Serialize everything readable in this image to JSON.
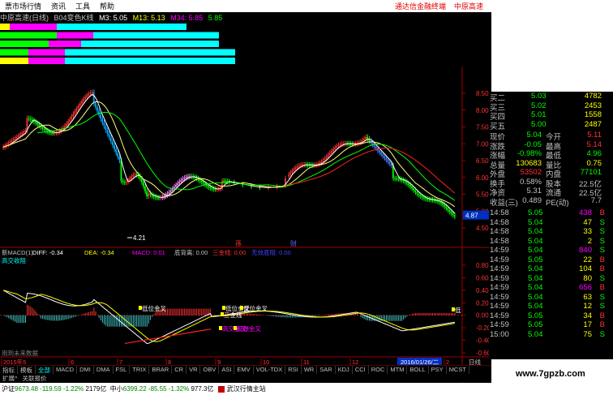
{
  "menu": [
    "票市场行情",
    "资讯",
    "工具",
    "帮助"
  ],
  "menu_ad": "通达信金融终端",
  "menu_ad2": "中原高速",
  "title": {
    "name": "中原高速(日线)",
    "indicator": "B04变色K线",
    "m3": "M3: 5.05",
    "m13": "M13: 5.13",
    "m34": "M34: 5.85",
    "m_extra": "5.85"
  },
  "price_axis": [
    "8.50",
    "8.00",
    "7.50",
    "7.00",
    "6.50",
    "6.00",
    "5.50",
    "5.00",
    "4.50"
  ],
  "last_price_tag": "4.87",
  "low_label": "4.21",
  "event_labels": [
    "孫",
    "财"
  ],
  "macd_header": {
    "name": "新MACD(1)",
    "diff": "DIFF: -0.34",
    "dea": "DEA: -0.34",
    "macd": "MACD: 0.01",
    "dbl": "底背离: 0.00",
    "sjx": "三金线: 0.00",
    "extra": "无效底阻: 0.00"
  },
  "macd_note": "高交收阻",
  "macd_axis": [
    "0.80",
    "0.60",
    "0.40",
    "0.20",
    "0.00",
    "-0.20",
    "-0.40",
    "-0.60"
  ],
  "annotations": [
    "低位金叉",
    "低位金叉",
    "低位金叉",
    "三金线",
    "高交金叉",
    "反弹金叉",
    "低"
  ],
  "hist_note": "用到未来数据",
  "time_axis": [
    "2015年5",
    "6",
    "7",
    "8",
    "9",
    "10",
    "11",
    "12",
    "2016/01/26/二",
    "2"
  ],
  "time_suffix": "日线",
  "tabs": [
    "指标",
    "模板",
    "全部",
    "MACD",
    "DMI",
    "DMA",
    "FSL",
    "TRIX",
    "BRAR",
    "CR",
    "VR",
    "OBV",
    "ASI",
    "EMV",
    "VOL-TDX",
    "RSI",
    "WR",
    "SAR",
    "KDJ",
    "CCI",
    "ROC",
    "MTM",
    "BOLL",
    "PSY",
    "MCST"
  ],
  "tabs2": [
    "扩展^",
    "关联报价"
  ],
  "order_book": [
    {
      "label": "买二",
      "price": "5.03",
      "vol": "4782"
    },
    {
      "label": "买三",
      "price": "5.02",
      "vol": "2453"
    },
    {
      "label": "买四",
      "price": "5.01",
      "vol": "1558"
    },
    {
      "label": "买五",
      "price": "5.00",
      "vol": "2487"
    }
  ],
  "stats": [
    {
      "l1": "现价",
      "v1": "5.04",
      "l2": "今开",
      "v2": "5.11"
    },
    {
      "l1": "涨跌",
      "v1": "-0.05",
      "l2": "最高",
      "v2": "5.14"
    },
    {
      "l1": "涨幅",
      "v1": "-0.98%",
      "l2": "最低",
      "v2": "4.96"
    },
    {
      "l1": "总量",
      "v1": "130683",
      "l2": "量比",
      "v2": "0.75"
    },
    {
      "l1": "外盘",
      "v1": "53502",
      "l2": "内盘",
      "v2": "77101"
    },
    {
      "l1": "换手",
      "v1": "0.58%",
      "l2": "股本",
      "v2": "22.5亿"
    },
    {
      "l1": "净资",
      "v1": "5.31",
      "l2": "流通",
      "v2": "22.5亿"
    },
    {
      "l1": "收益(三)",
      "v1": "0.489",
      "l2": "PE(动)",
      "v2": "7.7"
    }
  ],
  "ticks": [
    {
      "t": "14:58",
      "p": "5.05",
      "v": "438",
      "s": "B"
    },
    {
      "t": "14:58",
      "p": "5.04",
      "v": "47",
      "s": "S"
    },
    {
      "t": "14:58",
      "p": "5.04",
      "v": "33",
      "s": "S"
    },
    {
      "t": "14:58",
      "p": "5.04",
      "v": "2",
      "s": "S"
    },
    {
      "t": "14:59",
      "p": "5.04",
      "v": "840",
      "s": "S"
    },
    {
      "t": "14:59",
      "p": "5.05",
      "v": "22",
      "s": "B"
    },
    {
      "t": "14:59",
      "p": "5.04",
      "v": "104",
      "s": "B"
    },
    {
      "t": "14:59",
      "p": "5.04",
      "v": "80",
      "s": "S"
    },
    {
      "t": "14:59",
      "p": "5.04",
      "v": "656",
      "s": "B"
    },
    {
      "t": "14:59",
      "p": "5.04",
      "v": "63",
      "s": "S"
    },
    {
      "t": "14:59",
      "p": "5.04",
      "v": "12",
      "s": "S"
    },
    {
      "t": "14:59",
      "p": "5.05",
      "v": "34",
      "s": "B"
    },
    {
      "t": "14:59",
      "p": "5.05",
      "v": "17",
      "s": "B"
    },
    {
      "t": "15:00",
      "p": "5.04",
      "v": "75",
      "s": "S"
    }
  ],
  "status": {
    "sh_label": "沪证",
    "sh": "9673.48",
    "sh_chg": "-119.59",
    "sh_pct": "-1.22%",
    "sh_vol": "2179亿",
    "zx_label": "中小",
    "zx": "6399.22",
    "zx_chg": "-85.55",
    "zx_pct": "-1.32%",
    "zx_vol": "977.3亿",
    "site": "武汉行情主站"
  },
  "watermark": "www.7gpzb.com",
  "colors": {
    "up": "#ff3232",
    "down": "#00ff00",
    "flat": "#ffffff",
    "cyan": "#00ffff",
    "magenta": "#ff00ff",
    "yellow": "#ffff00",
    "ma": "#00ff00",
    "ma_red": "#ff0000"
  }
}
